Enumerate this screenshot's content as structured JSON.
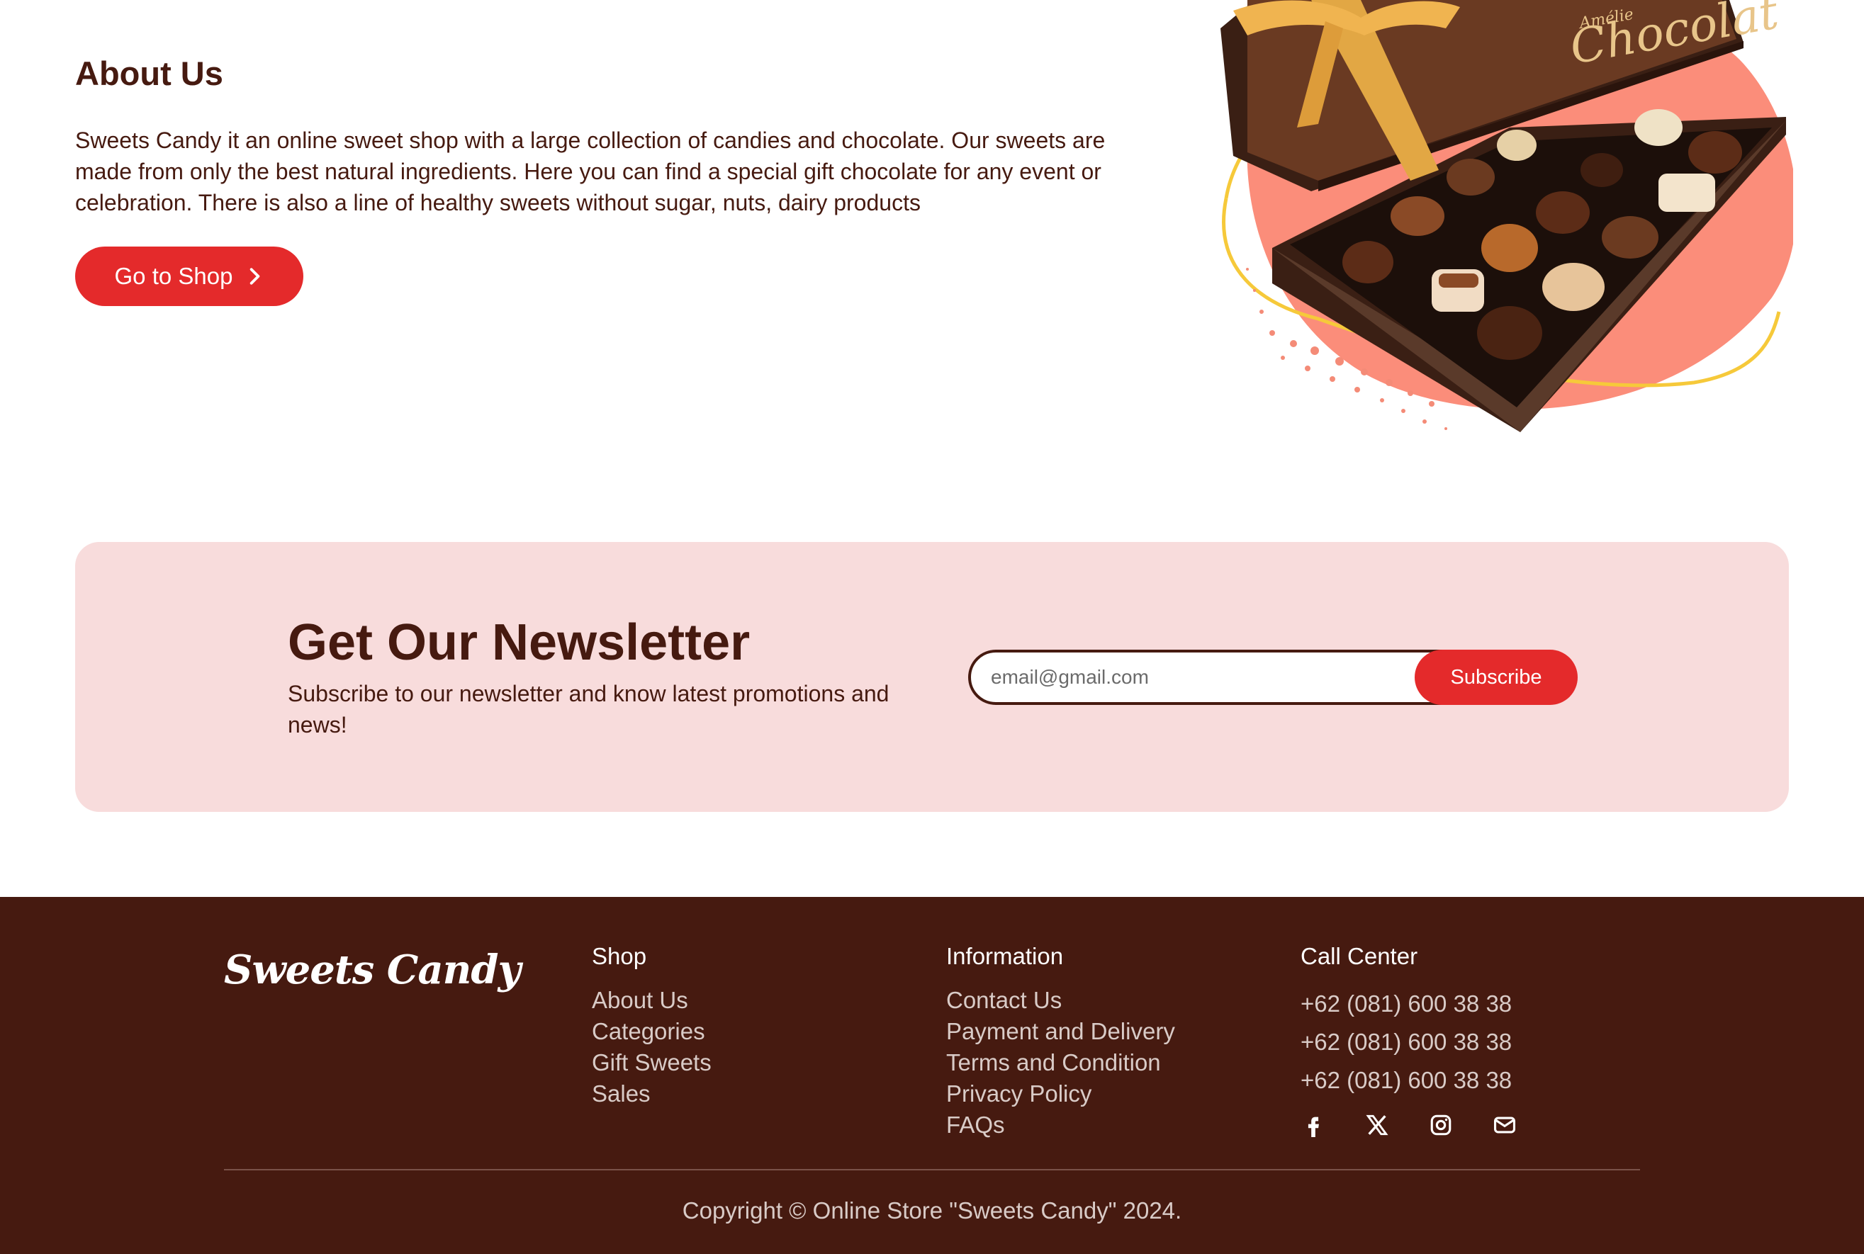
{
  "about": {
    "title": "About Us",
    "text": "Sweets Candy it an online sweet shop with a large collection of candies and chocolate. Our sweets are made from only the best natural ingredients. Here you can find a special gift chocolate for any event or celebration. There is also a line of healthy sweets without sugar, nuts, dairy products",
    "button_label": "Go to Shop",
    "image_box_text": "Chocolat",
    "image_ribbon_text": "Amélie"
  },
  "newsletter": {
    "title": "Get Our Newsletter",
    "subtitle": "Subscribe to our newsletter and know latest promotions and news!",
    "email_placeholder": "email@gmail.com",
    "subscribe_label": "Subscribe"
  },
  "footer": {
    "logo": "Sweets Candy",
    "shop": {
      "heading": "Shop",
      "links": [
        "About Us",
        "Categories",
        "Gift Sweets",
        "Sales"
      ]
    },
    "information": {
      "heading": "Information",
      "links": [
        "Contact Us",
        "Payment and Delivery",
        "Terms and Condition",
        "Privacy Policy",
        "FAQs"
      ]
    },
    "call_center": {
      "heading": "Call Center",
      "phones": [
        "+62 (081) 600 38 38",
        "+62 (081) 600 38 38",
        "+62 (081) 600 38 38"
      ]
    },
    "social_icons": [
      "facebook-icon",
      "x-icon",
      "instagram-icon",
      "mail-icon"
    ],
    "copyright": "Copyright © Online Store \"Sweets Candy\" 2024."
  },
  "colors": {
    "brand_brown": "#461a10",
    "accent_red": "#e42a2b",
    "newsletter_bg": "#f8dcdc"
  }
}
